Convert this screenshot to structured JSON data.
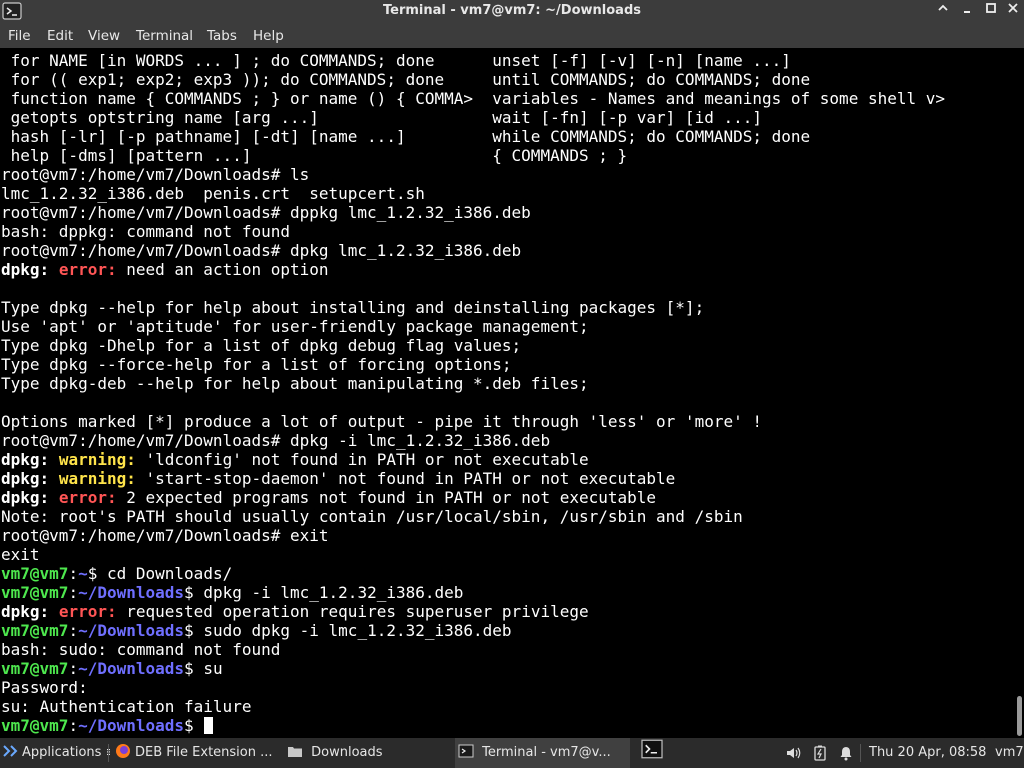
{
  "window": {
    "title": "Terminal - vm7@vm7: ~/Downloads",
    "controls": {
      "minimize": "▲",
      "maximize": "▫",
      "restore": "■",
      "close": "✕"
    }
  },
  "menu": [
    "File",
    "Edit",
    "View",
    "Terminal",
    "Tabs",
    "Help"
  ],
  "terminal": {
    "lines": [
      [
        {
          "t": " for NAME [in WORDS ... ] ; do COMMANDS; done      unset [-f] [-v] [-n] [name ...]"
        }
      ],
      [
        {
          "t": " for (( exp1; exp2; exp3 )); do COMMANDS; done     until COMMANDS; do COMMANDS; done"
        }
      ],
      [
        {
          "t": " function name { COMMANDS ; } or name () { COMMA>  variables - Names and meanings of some shell v>"
        }
      ],
      [
        {
          "t": " getopts optstring name [arg ...]                  wait [-fn] [-p var] [id ...]"
        }
      ],
      [
        {
          "t": " hash [-lr] [-p pathname] [-dt] [name ...]         while COMMANDS; do COMMANDS; done"
        }
      ],
      [
        {
          "t": " help [-dms] [pattern ...]                         { COMMANDS ; }"
        }
      ],
      [
        {
          "t": "root@vm7:/home/vm7/Downloads# ls"
        }
      ],
      [
        {
          "t": "lmc_1.2.32_i386.deb  penis.crt  setupcert.sh"
        }
      ],
      [
        {
          "t": "root@vm7:/home/vm7/Downloads# dppkg lmc_1.2.32_i386.deb"
        }
      ],
      [
        {
          "t": "bash: dppkg: command not found"
        }
      ],
      [
        {
          "t": "root@vm7:/home/vm7/Downloads# dpkg lmc_1.2.32_i386.deb"
        }
      ],
      [
        {
          "t": "dpkg:",
          "c": "bold"
        },
        {
          "t": " "
        },
        {
          "t": "error:",
          "c": "err"
        },
        {
          "t": " need an action option"
        }
      ],
      [
        {
          "t": ""
        }
      ],
      [
        {
          "t": "Type dpkg --help for help about installing and deinstalling packages [*];"
        }
      ],
      [
        {
          "t": "Use 'apt' or 'aptitude' for user-friendly package management;"
        }
      ],
      [
        {
          "t": "Type dpkg -Dhelp for a list of dpkg debug flag values;"
        }
      ],
      [
        {
          "t": "Type dpkg --force-help for a list of forcing options;"
        }
      ],
      [
        {
          "t": "Type dpkg-deb --help for help about manipulating *.deb files;"
        }
      ],
      [
        {
          "t": ""
        }
      ],
      [
        {
          "t": "Options marked [*] produce a lot of output - pipe it through 'less' or 'more' !"
        }
      ],
      [
        {
          "t": "root@vm7:/home/vm7/Downloads# dpkg -i lmc_1.2.32_i386.deb"
        }
      ],
      [
        {
          "t": "dpkg:",
          "c": "bold"
        },
        {
          "t": " "
        },
        {
          "t": "warning:",
          "c": "warn"
        },
        {
          "t": " 'ldconfig' not found in PATH or not executable"
        }
      ],
      [
        {
          "t": "dpkg:",
          "c": "bold"
        },
        {
          "t": " "
        },
        {
          "t": "warning:",
          "c": "warn"
        },
        {
          "t": " 'start-stop-daemon' not found in PATH or not executable"
        }
      ],
      [
        {
          "t": "dpkg:",
          "c": "bold"
        },
        {
          "t": " "
        },
        {
          "t": "error:",
          "c": "err"
        },
        {
          "t": " 2 expected programs not found in PATH or not executable"
        }
      ],
      [
        {
          "t": "Note: root's PATH should usually contain /usr/local/sbin, /usr/sbin and /sbin"
        }
      ],
      [
        {
          "t": "root@vm7:/home/vm7/Downloads# exit"
        }
      ],
      [
        {
          "t": "exit"
        }
      ],
      [
        {
          "t": "vm7@vm7",
          "c": "g"
        },
        {
          "t": ":"
        },
        {
          "t": "~",
          "c": "b"
        },
        {
          "t": "$ cd Downloads/"
        }
      ],
      [
        {
          "t": "vm7@vm7",
          "c": "g"
        },
        {
          "t": ":"
        },
        {
          "t": "~/Downloads",
          "c": "b"
        },
        {
          "t": "$ dpkg -i lmc_1.2.32_i386.deb"
        }
      ],
      [
        {
          "t": "dpkg:",
          "c": "bold"
        },
        {
          "t": " "
        },
        {
          "t": "error:",
          "c": "err"
        },
        {
          "t": " requested operation requires superuser privilege"
        }
      ],
      [
        {
          "t": "vm7@vm7",
          "c": "g"
        },
        {
          "t": ":"
        },
        {
          "t": "~/Downloads",
          "c": "b"
        },
        {
          "t": "$ sudo dpkg -i lmc_1.2.32_i386.deb"
        }
      ],
      [
        {
          "t": "bash: sudo: command not found"
        }
      ],
      [
        {
          "t": "vm7@vm7",
          "c": "g"
        },
        {
          "t": ":"
        },
        {
          "t": "~/Downloads",
          "c": "b"
        },
        {
          "t": "$ su"
        }
      ],
      [
        {
          "t": "Password:"
        }
      ],
      [
        {
          "t": "su: Authentication failure"
        }
      ],
      [
        {
          "t": "vm7@vm7",
          "c": "g"
        },
        {
          "t": ":"
        },
        {
          "t": "~/Downloads",
          "c": "b"
        },
        {
          "t": "$ "
        }
      ]
    ]
  },
  "taskbar": {
    "applications_label": "Applications",
    "applications_suffix": "≡",
    "tasks": [
      {
        "label": "DEB File Extension ...",
        "icon": "firefox-icon"
      },
      {
        "label": "Downloads",
        "icon": "folder-icon"
      },
      {
        "label": "Terminal - vm7@v...",
        "icon": "terminal-icon"
      }
    ],
    "clock": "Thu 20 Apr, 08:58",
    "user": "vm7"
  },
  "colors": {
    "prompt_user": "#4ee84e",
    "prompt_path": "#6f6fff",
    "error": "#ff5555",
    "warning": "#ffe44a"
  }
}
